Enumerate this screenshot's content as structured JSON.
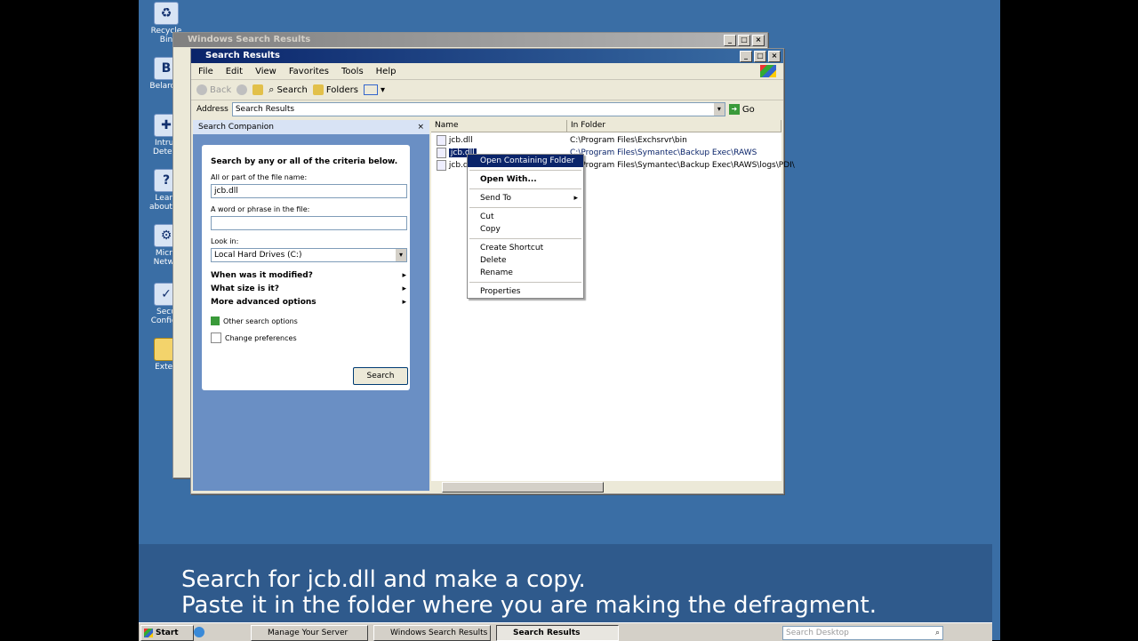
{
  "desktop_icons": [
    {
      "label": "Recycle Bin",
      "icon": "recycle-bin-icon"
    },
    {
      "label": "Belarc A",
      "icon": "advisor-icon"
    },
    {
      "label": "Intrus Detect",
      "icon": "intrusion-icon"
    },
    {
      "label": "Learn about th",
      "icon": "learn-icon"
    },
    {
      "label": "Micro Netwo",
      "icon": "network-icon"
    },
    {
      "label": "Secu Configu",
      "icon": "security-config-icon"
    },
    {
      "label": "Exten",
      "icon": "folder-icon"
    }
  ],
  "back_window": {
    "title": "Windows Search Results"
  },
  "main_window": {
    "title": "Search Results",
    "menu": [
      "File",
      "Edit",
      "View",
      "Favorites",
      "Tools",
      "Help"
    ],
    "toolbar": {
      "back": "Back",
      "search": "Search",
      "folders": "Folders"
    },
    "address": {
      "label": "Address",
      "value": "Search Results",
      "go": "Go"
    },
    "companion": {
      "header": "Search Companion",
      "close": "×",
      "heading": "Search by any or all of the criteria below.",
      "filename_label": "All or part of the file name:",
      "filename_value": "jcb.dll",
      "phrase_label": "A word or phrase in the file:",
      "phrase_value": "",
      "lookin_label": "Look in:",
      "lookin_value": "Local Hard Drives (C:)",
      "options": [
        "When was it modified?",
        "What size is it?",
        "More advanced options"
      ],
      "links": [
        "Other search options",
        "Change preferences"
      ],
      "search_button": "Search"
    },
    "columns": [
      "Name",
      "In Folder"
    ],
    "results": [
      {
        "name": "jcb.dll",
        "folder": "C:\\Program Files\\Exchsrvr\\bin"
      },
      {
        "name": "jcb.dll",
        "folder": "C:\\Program Files\\Symantec\\Backup Exec\\RAWS"
      },
      {
        "name": "jcb.dll",
        "folder": "C:\\Program Files\\Symantec\\Backup Exec\\RAWS\\logs\\PDI\\"
      }
    ]
  },
  "context_menu": [
    "Open Containing Folder",
    "Open With...",
    "Send To",
    "Cut",
    "Copy",
    "Create Shortcut",
    "Delete",
    "Rename",
    "Properties"
  ],
  "caption": {
    "line1": "Search for jcb.dll and make a copy.",
    "line2": "Paste it in the folder where you are making the defragment."
  },
  "taskbar": {
    "start": "Start",
    "tasks": [
      "Manage Your Server",
      "Windows Search Results",
      "Search Results"
    ],
    "search_placeholder": "Search Desktop"
  },
  "colors": {
    "desktop": "#3a6ea5",
    "titlebar": "#0a246a",
    "panel": "#6a8fc4",
    "selection": "#0a246a"
  }
}
